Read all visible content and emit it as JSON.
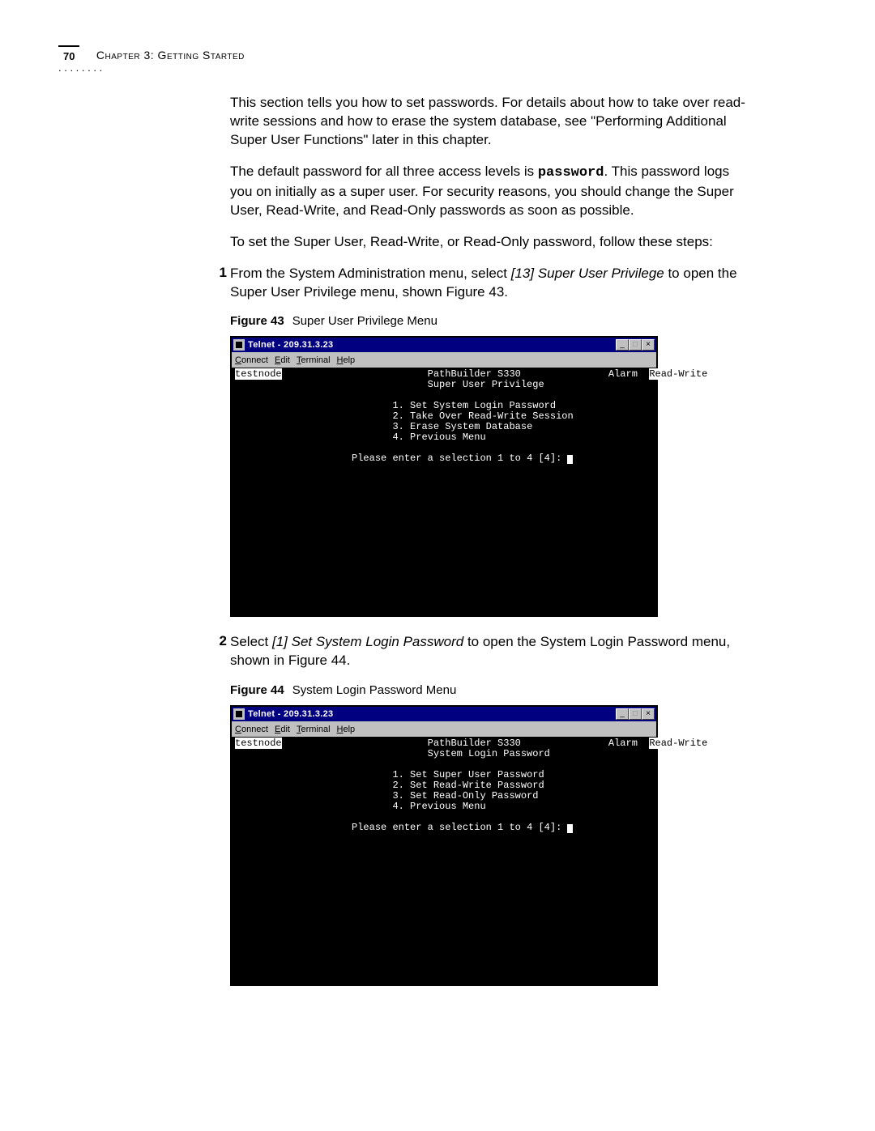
{
  "header": {
    "page_number": "70",
    "chapter": "Chapter 3: Getting Started"
  },
  "body": {
    "p1": "This section tells you how to set passwords. For details about how to take over read-write sessions and how to erase the system database, see \"Performing Additional Super User Functions\" later in this chapter.",
    "p2_a": "The default password for all three access levels is ",
    "p2_pw": "password",
    "p2_b": ". This password logs you on initially as a super user. For security reasons, you should change the Super User, Read-Write, and Read-Only passwords as soon as possible.",
    "p3": "To set the Super User, Read-Write, or Read-Only password, follow these steps:",
    "step1_num": "1",
    "step1_a": "From the System Administration menu, select ",
    "step1_em": "[13] Super User Privilege",
    "step1_b": " to open the Super User Privilege menu, shown Figure 43.",
    "fig43_label": "Figure 43",
    "fig43_title": "Super User Privilege Menu",
    "step2_num": "2",
    "step2_a": "Select ",
    "step2_em": "[1] Set System Login Password",
    "step2_b": " to open the System Login Password menu, shown in Figure 44.",
    "fig44_label": "Figure 44",
    "fig44_title": "System Login Password Menu"
  },
  "telnet_common": {
    "title": "Telnet - 209.31.3.23",
    "menu_connect": "Connect",
    "menu_edit": "Edit",
    "menu_terminal": "Terminal",
    "menu_help": "Help",
    "nodename": "testnode",
    "device": "PathBuilder S330",
    "alarm": "Alarm",
    "mode": "Read-Write",
    "prompt": "Please enter a selection 1 to 4 [4]:"
  },
  "fig43": {
    "subtitle": "Super User Privilege",
    "items": [
      "1. Set System Login Password",
      "2. Take Over Read-Write Session",
      "3. Erase System Database",
      "4. Previous Menu"
    ]
  },
  "fig44": {
    "subtitle": "System Login Password",
    "items": [
      "1. Set Super User Password",
      "2. Set Read-Write Password",
      "3. Set Read-Only Password",
      "4. Previous Menu"
    ]
  }
}
